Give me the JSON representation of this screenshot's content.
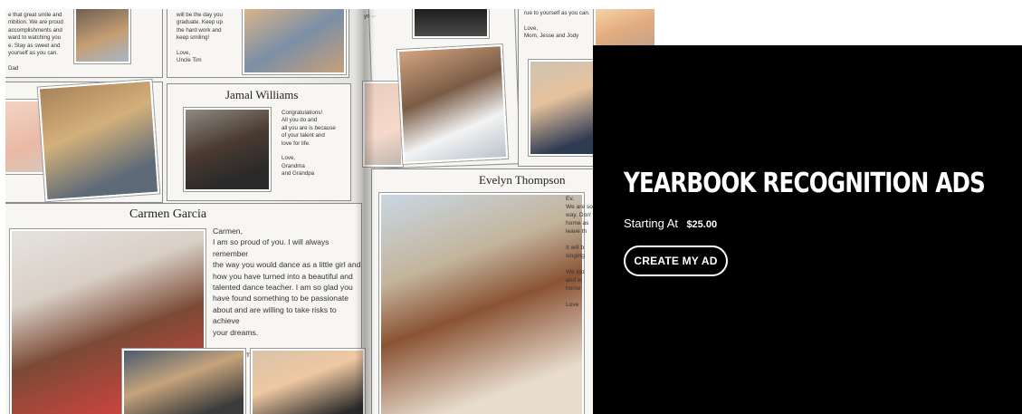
{
  "hero": {
    "alt": "Open yearbook with recognition ad pages",
    "pages": {
      "top_left_note": "e that great smile and\nmbition. We are proud\naccomplishments and\nward to watching you\ne. Stay as sweet and\nyourself as you can.\n\nDad",
      "top_center_note": "will be the day you\ngraduate. Keep up\nthe hard work and\nkeep smiling!\n\nLove,\nUncle Tim",
      "jamal_name": "Jamal Williams",
      "jamal_note": "Congratulations!\nAll you do and\nall you are is because\nof your talent and\nlove for life.\n\nLove,\nGrandma\nand Grandpa",
      "carmen_name": "Carmen Garcia",
      "carmen_note": "Carmen,\nI am so proud of you. I will always remember\nthe way you would dance as a little girl and\nhow you have turned into a beautiful and\ntalented dance teacher. I am so glad you\nhave found something to be passionate\nabout and are willing to take risks to achieve\nyour dreams.\n\nLove, Mom",
      "evelyn_name": "Evelyn Thompson",
      "evelyn_note": "Ev,\nWe are so\nway. Don'\nhome as\nleave th\n\nIt will b\nsinging\n\nWe loo\nand w\nhome\n\nLove",
      "top_right_note": "rue to yourself as you can.\n\nLove,\nMom, Jesse and Jody"
    }
  },
  "promo": {
    "title": "YEARBOOK RECOGNITION ADS",
    "price_label": "Starting At",
    "price_value": "$25.00",
    "cta_label": "CREATE MY AD"
  },
  "colors": {
    "panel_background": "#000000",
    "panel_text": "#ffffff"
  }
}
